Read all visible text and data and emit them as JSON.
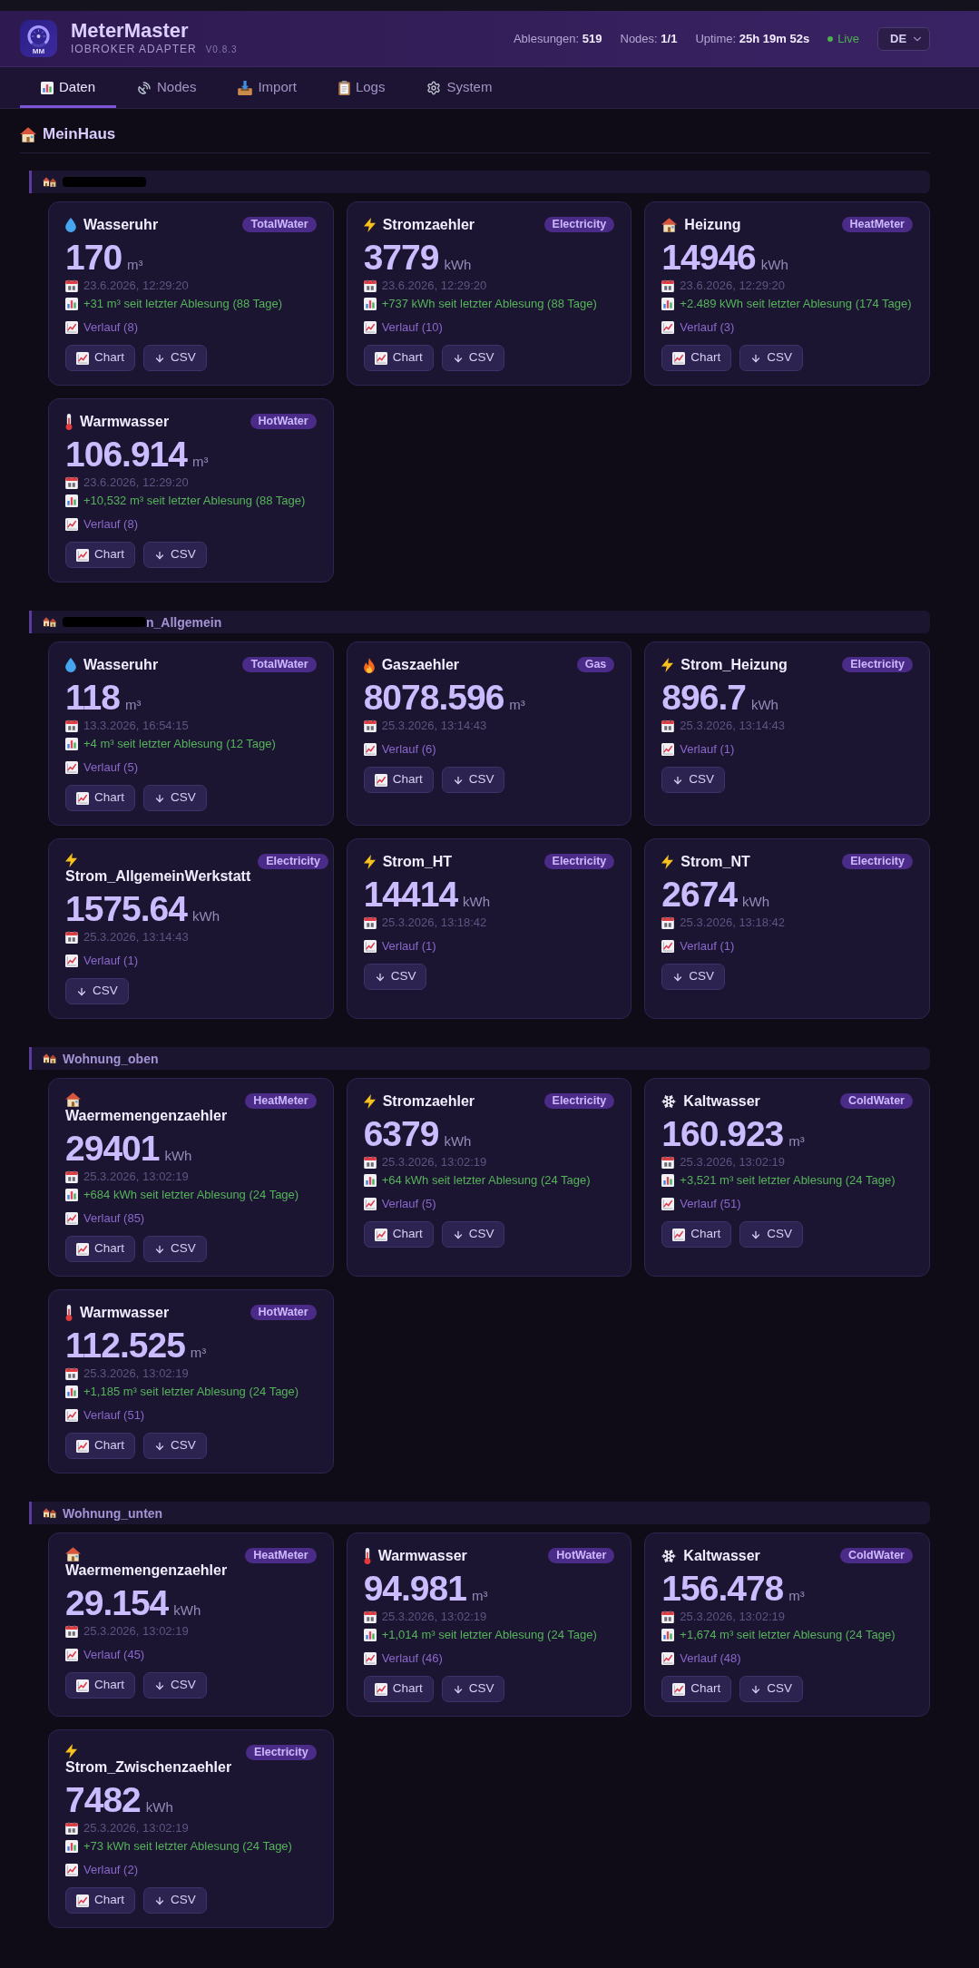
{
  "header": {
    "logo_text": "MM",
    "title": "MeterMaster",
    "subtitle": "IOBROKER ADAPTER",
    "version": "V0.8.3",
    "stats": [
      "Ablesungen: **519**",
      "Nodes: **1/1**",
      "Uptime: **25h 19m 52s**"
    ],
    "status": {
      "label": "Live",
      "online": true
    },
    "language": "DE"
  },
  "tabs": [
    {
      "kind": "data",
      "label": "Daten",
      "selected": true
    },
    {
      "kind": "nodes",
      "label": "Nodes",
      "selected": false
    },
    {
      "kind": "import",
      "label": "Import",
      "selected": false
    },
    {
      "kind": "logs",
      "label": "Logs",
      "selected": false
    },
    {
      "kind": "system",
      "label": "System",
      "selected": false
    }
  ],
  "page_title": "MeinHaus",
  "groups": [
    {
      "redacted": true,
      "meters": [
        {
          "kind": "water",
          "name": "Wasseruhr",
          "type": "TotalWater",
          "value": "170",
          "unit": "m³",
          "date": "23.6.2026, 12:29:20",
          "delta": "+31 m³ seit letzter Ablesung (88 Tage)",
          "history": "Verlauf (8)",
          "actions": [
            {
              "kind": "chart",
              "label": "Chart"
            },
            {
              "kind": "csv",
              "label": "CSV"
            }
          ]
        },
        {
          "kind": "electricity",
          "name": "Stromzaehler",
          "type": "Electricity",
          "value": "3779",
          "unit": "kWh",
          "date": "23.6.2026, 12:29:20",
          "delta": "+737 kWh seit letzter Ablesung (88 Tage)",
          "history": "Verlauf (10)",
          "actions": [
            {
              "kind": "chart",
              "label": "Chart"
            },
            {
              "kind": "csv",
              "label": "CSV"
            }
          ]
        },
        {
          "kind": "heat",
          "name": "Heizung",
          "type": "HeatMeter",
          "value": "14946",
          "unit": "kWh",
          "date": "23.6.2026, 12:29:20",
          "delta": "+2.489 kWh seit letzter Ablesung (174 Tage)",
          "history": "Verlauf (3)",
          "actions": [
            {
              "kind": "chart",
              "label": "Chart"
            },
            {
              "kind": "csv",
              "label": "CSV"
            }
          ]
        },
        {
          "kind": "hotwater",
          "name": "Warmwasser",
          "type": "HotWater",
          "value": "106.914",
          "unit": "m³",
          "date": "23.6.2026, 12:29:20",
          "delta": "+10,532 m³ seit letzter Ablesung (88 Tage)",
          "history": "Verlauf (8)",
          "actions": [
            {
              "kind": "chart",
              "label": "Chart"
            },
            {
              "kind": "csv",
              "label": "CSV"
            }
          ]
        }
      ]
    },
    {
      "redacted": true,
      "name": "n_Allgemein",
      "meters": [
        {
          "kind": "water",
          "name": "Wasseruhr",
          "type": "TotalWater",
          "value": "118",
          "unit": "m³",
          "date": "13.3.2026, 16:54:15",
          "delta": "+4 m³ seit letzter Ablesung (12 Tage)",
          "history": "Verlauf (5)",
          "actions": [
            {
              "kind": "chart",
              "label": "Chart"
            },
            {
              "kind": "csv",
              "label": "CSV"
            }
          ]
        },
        {
          "kind": "gas",
          "name": "Gaszaehler",
          "type": "Gas",
          "value": "8078.596",
          "unit": "m³",
          "date": "25.3.2026, 13:14:43",
          "history": "Verlauf (6)",
          "actions": [
            {
              "kind": "chart",
              "label": "Chart"
            },
            {
              "kind": "csv",
              "label": "CSV"
            }
          ]
        },
        {
          "kind": "electricity",
          "name": "Strom_Heizung",
          "type": "Electricity",
          "value": "896.7",
          "unit": "kWh",
          "date": "25.3.2026, 13:14:43",
          "history": "Verlauf (1)",
          "actions": [
            {
              "kind": "csv",
              "label": "CSV"
            }
          ]
        },
        {
          "kind": "electricity",
          "name": "Strom_AllgemeinWerkstatt",
          "type": "Electricity",
          "value": "1575.64",
          "unit": "kWh",
          "date": "25.3.2026, 13:14:43",
          "history": "Verlauf (1)",
          "actions": [
            {
              "kind": "csv",
              "label": "CSV"
            }
          ]
        },
        {
          "kind": "electricity",
          "name": "Strom_HT",
          "type": "Electricity",
          "value": "14414",
          "unit": "kWh",
          "date": "25.3.2026, 13:18:42",
          "history": "Verlauf (1)",
          "actions": [
            {
              "kind": "csv",
              "label": "CSV"
            }
          ]
        },
        {
          "kind": "electricity",
          "name": "Strom_NT",
          "type": "Electricity",
          "value": "2674",
          "unit": "kWh",
          "date": "25.3.2026, 13:18:42",
          "history": "Verlauf (1)",
          "actions": [
            {
              "kind": "csv",
              "label": "CSV"
            }
          ]
        }
      ]
    },
    {
      "redacted": false,
      "name": "Wohnung_oben",
      "meters": [
        {
          "kind": "heat",
          "name": "Waermemengenzaehler",
          "type": "HeatMeter",
          "value": "29401",
          "unit": "kWh",
          "date": "25.3.2026, 13:02:19",
          "delta": "+684 kWh seit letzter Ablesung (24 Tage)",
          "history": "Verlauf (85)",
          "actions": [
            {
              "kind": "chart",
              "label": "Chart"
            },
            {
              "kind": "csv",
              "label": "CSV"
            }
          ]
        },
        {
          "kind": "electricity",
          "name": "Stromzaehler",
          "type": "Electricity",
          "value": "6379",
          "unit": "kWh",
          "date": "25.3.2026, 13:02:19",
          "delta": "+64 kWh seit letzter Ablesung (24 Tage)",
          "history": "Verlauf (5)",
          "actions": [
            {
              "kind": "chart",
              "label": "Chart"
            },
            {
              "kind": "csv",
              "label": "CSV"
            }
          ]
        },
        {
          "kind": "coldwater",
          "name": "Kaltwasser",
          "type": "ColdWater",
          "value": "160.923",
          "unit": "m³",
          "date": "25.3.2026, 13:02:19",
          "delta": "+3,521 m³ seit letzter Ablesung (24 Tage)",
          "history": "Verlauf (51)",
          "actions": [
            {
              "kind": "chart",
              "label": "Chart"
            },
            {
              "kind": "csv",
              "label": "CSV"
            }
          ]
        },
        {
          "kind": "hotwater",
          "name": "Warmwasser",
          "type": "HotWater",
          "value": "112.525",
          "unit": "m³",
          "date": "25.3.2026, 13:02:19",
          "delta": "+1,185 m³ seit letzter Ablesung (24 Tage)",
          "history": "Verlauf (51)",
          "actions": [
            {
              "kind": "chart",
              "label": "Chart"
            },
            {
              "kind": "csv",
              "label": "CSV"
            }
          ]
        }
      ]
    },
    {
      "redacted": false,
      "name": "Wohnung_unten",
      "meters": [
        {
          "kind": "heat",
          "name": "Waermemengenzaehler",
          "type": "HeatMeter",
          "value": "29.154",
          "unit": "kWh",
          "date": "25.3.2026, 13:02:19",
          "history": "Verlauf (45)",
          "actions": [
            {
              "kind": "chart",
              "label": "Chart"
            },
            {
              "kind": "csv",
              "label": "CSV"
            }
          ]
        },
        {
          "kind": "hotwater",
          "name": "Warmwasser",
          "type": "HotWater",
          "value": "94.981",
          "unit": "m³",
          "date": "25.3.2026, 13:02:19",
          "delta": "+1,014 m³ seit letzter Ablesung (24 Tage)",
          "history": "Verlauf (46)",
          "actions": [
            {
              "kind": "chart",
              "label": "Chart"
            },
            {
              "kind": "csv",
              "label": "CSV"
            }
          ]
        },
        {
          "kind": "coldwater",
          "name": "Kaltwasser",
          "type": "ColdWater",
          "value": "156.478",
          "unit": "m³",
          "date": "25.3.2026, 13:02:19",
          "delta": "+1,674 m³ seit letzter Ablesung (24 Tage)",
          "history": "Verlauf (48)",
          "actions": [
            {
              "kind": "chart",
              "label": "Chart"
            },
            {
              "kind": "csv",
              "label": "CSV"
            }
          ]
        },
        {
          "kind": "electricity",
          "name": "Strom_Zwischenzaehler",
          "type": "Electricity",
          "value": "7482",
          "unit": "kWh",
          "date": "25.3.2026, 13:02:19",
          "delta": "+73 kWh seit letzter Ablesung (24 Tage)",
          "history": "Verlauf (2)",
          "actions": [
            {
              "kind": "chart",
              "label": "Chart"
            },
            {
              "kind": "csv",
              "label": "CSV"
            }
          ]
        }
      ]
    }
  ]
}
